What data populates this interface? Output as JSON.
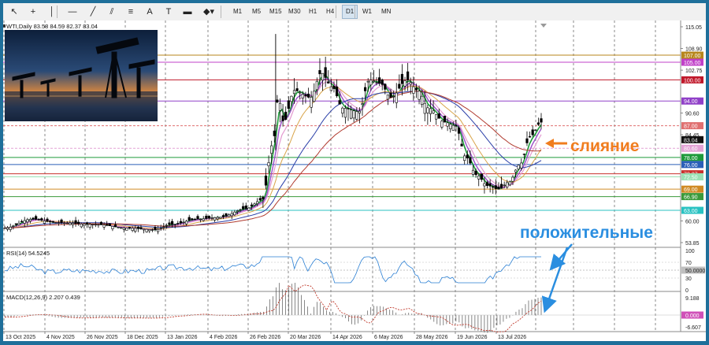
{
  "toolbar": {
    "tools": [
      {
        "name": "cursor-icon",
        "glyph": "↖"
      },
      {
        "name": "crosshair-icon",
        "glyph": "+"
      },
      {
        "name": "vertical-line-icon",
        "glyph": "│"
      },
      {
        "name": "horizontal-line-icon",
        "glyph": "—"
      },
      {
        "name": "trendline-icon",
        "glyph": "╱"
      },
      {
        "name": "equidistant-channel-icon",
        "glyph": "⫽"
      },
      {
        "name": "fibonacci-icon",
        "glyph": "≡"
      },
      {
        "name": "text-icon",
        "glyph": "A"
      },
      {
        "name": "text-label-icon",
        "glyph": "T"
      },
      {
        "name": "rectangle-icon",
        "glyph": "▬"
      },
      {
        "name": "shapes-icon",
        "glyph": "◆▾"
      }
    ],
    "timeframes": [
      "M1",
      "M5",
      "M15",
      "M30",
      "H1",
      "H4",
      "D1",
      "W1",
      "MN"
    ],
    "active_timeframe": "D1"
  },
  "chart_header": "WTI,Daily  83.58 84.59 82.37 83.04",
  "annotations": {
    "merge": "слияние",
    "positive": "положительные"
  },
  "colors": {
    "annotation_orange": "#f07d1e",
    "annotation_blue": "#2a8ee0",
    "price_tag": "#1e1e1e"
  },
  "price_axis": [
    "115.05",
    "108.90",
    "102.75",
    "90.60",
    "84.45",
    "60.00",
    "53.85"
  ],
  "price_levels": [
    {
      "label": "107.00",
      "color": "#b7861b"
    },
    {
      "label": "105.00",
      "color": "#c040c8"
    },
    {
      "label": "100.00",
      "color": "#c0182a"
    },
    {
      "label": "94.00",
      "color": "#9040c8"
    },
    {
      "label": "87.00",
      "color": "#e07070"
    },
    {
      "label": "83.04",
      "color": "#111111"
    },
    {
      "label": "80.60",
      "color": "#e3a3d6"
    },
    {
      "label": "78.00",
      "color": "#1e9a3a"
    },
    {
      "label": "76.00",
      "color": "#2a5fb8"
    },
    {
      "label": "73.37",
      "color": "#c9302c"
    },
    {
      "label": "72.50",
      "color": "#9be0b4"
    },
    {
      "label": "69.00",
      "color": "#d08a24"
    },
    {
      "label": "66.90",
      "color": "#3a9a3a"
    },
    {
      "label": "63.00",
      "color": "#29c2c2"
    }
  ],
  "rsi": {
    "label": "RSI(14) 54.5245",
    "axis": [
      "100",
      "70",
      "50.0000",
      "30",
      "0"
    ]
  },
  "macd": {
    "label": "MACD(12,26,9) 2.207 0.439",
    "axis": [
      "9.188",
      "0.000",
      "-6.607"
    ]
  },
  "date_axis": [
    "13 Oct 2025",
    "4 Nov 2025",
    "26 Nov 2025",
    "18 Dec 2025",
    "13 Jan 2026",
    "4 Feb 2026",
    "26 Feb 2026",
    "20 Mar 2026",
    "14 Apr 2026",
    "6 May 2026",
    "28 May 2026",
    "19 Jun 2026",
    "13 Jul 2026"
  ]
}
